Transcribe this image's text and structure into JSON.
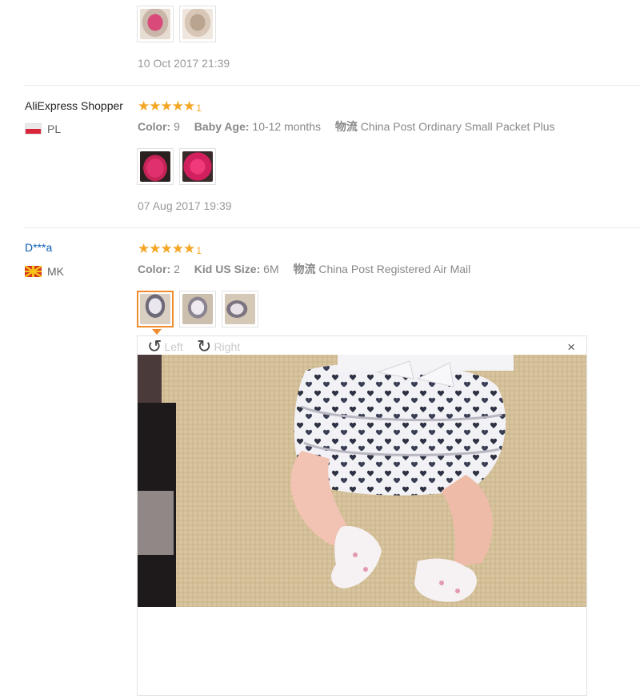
{
  "review1": {
    "date": "10 Oct 2017 21:39",
    "thumbnails": [
      "pink-pants-photo-1",
      "pink-pants-photo-2"
    ]
  },
  "review2": {
    "user": "AliExpress Shopper",
    "country": "PL",
    "rating": 5,
    "rating_note": "1",
    "color_label": "Color:",
    "color_value": "9",
    "age_label": "Baby Age:",
    "age_value": "10-12 months",
    "shipping_label": "物流",
    "shipping_value": "China Post Ordinary Small Packet Plus",
    "thumbnails": [
      "pink-bloomer-photo-1",
      "pink-bloomer-photo-2"
    ],
    "date": "07 Aug 2017 19:39"
  },
  "review3": {
    "user": "D***a",
    "country": "MK",
    "rating": 5,
    "rating_note": "1",
    "color_label": "Color:",
    "color_value": "2",
    "size_label": "Kid US Size:",
    "size_value": "6M",
    "shipping_label": "物流",
    "shipping_value": "China Post Registered Air Mail",
    "thumbnails": [
      "heart-bloomer-photo-1",
      "heart-bloomer-photo-2",
      "heart-bloomer-photo-3"
    ]
  },
  "viewer": {
    "rotate_left_label": "Left",
    "rotate_right_label": "Right",
    "close_label": "×",
    "image": "baby-in-heart-print-bloomers"
  },
  "colors": {
    "star": "#f5a623",
    "active_thumb": "#f08b2e",
    "link": "#0b5fb5"
  }
}
